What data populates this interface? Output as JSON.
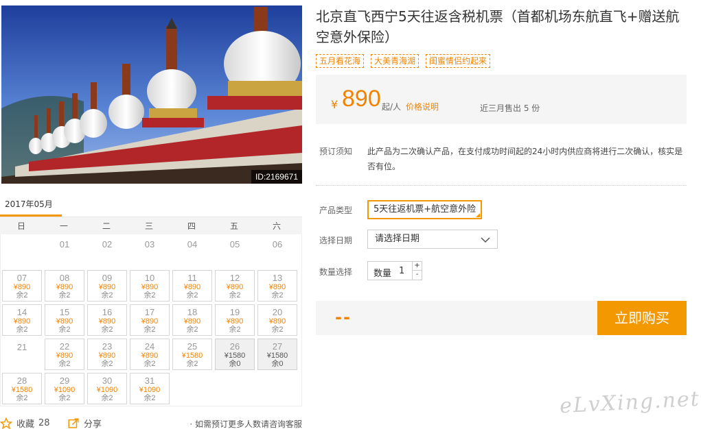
{
  "photo": {
    "id_label": "ID:2169671"
  },
  "calendar": {
    "month": "2017年05月",
    "weekdays": [
      "日",
      "一",
      "二",
      "三",
      "四",
      "五",
      "六"
    ],
    "days": [
      {
        "d": "",
        "p": "",
        "r": "",
        "s": "empty"
      },
      {
        "d": "01",
        "p": "",
        "r": "",
        "s": "plain"
      },
      {
        "d": "02",
        "p": "",
        "r": "",
        "s": "plain"
      },
      {
        "d": "03",
        "p": "",
        "r": "",
        "s": "plain"
      },
      {
        "d": "04",
        "p": "",
        "r": "",
        "s": "plain"
      },
      {
        "d": "05",
        "p": "",
        "r": "",
        "s": "plain"
      },
      {
        "d": "06",
        "p": "",
        "r": "",
        "s": "plain"
      },
      {
        "d": "07",
        "p": "¥890",
        "r": "余2",
        "s": "avail"
      },
      {
        "d": "08",
        "p": "¥890",
        "r": "余2",
        "s": "avail"
      },
      {
        "d": "09",
        "p": "¥890",
        "r": "余2",
        "s": "avail"
      },
      {
        "d": "10",
        "p": "¥890",
        "r": "余2",
        "s": "avail"
      },
      {
        "d": "11",
        "p": "¥890",
        "r": "余2",
        "s": "avail"
      },
      {
        "d": "12",
        "p": "¥890",
        "r": "余2",
        "s": "avail"
      },
      {
        "d": "13",
        "p": "¥890",
        "r": "余2",
        "s": "avail"
      },
      {
        "d": "14",
        "p": "¥890",
        "r": "余2",
        "s": "avail"
      },
      {
        "d": "15",
        "p": "¥890",
        "r": "余2",
        "s": "avail"
      },
      {
        "d": "16",
        "p": "¥890",
        "r": "余2",
        "s": "avail"
      },
      {
        "d": "17",
        "p": "¥890",
        "r": "余2",
        "s": "avail"
      },
      {
        "d": "18",
        "p": "¥890",
        "r": "余2",
        "s": "avail"
      },
      {
        "d": "19",
        "p": "¥890",
        "r": "余2",
        "s": "avail"
      },
      {
        "d": "20",
        "p": "¥890",
        "r": "余2",
        "s": "avail"
      },
      {
        "d": "21",
        "p": "",
        "r": "",
        "s": "plain"
      },
      {
        "d": "22",
        "p": "¥890",
        "r": "余2",
        "s": "avail"
      },
      {
        "d": "23",
        "p": "¥890",
        "r": "余2",
        "s": "avail"
      },
      {
        "d": "24",
        "p": "¥890",
        "r": "余2",
        "s": "avail"
      },
      {
        "d": "25",
        "p": "¥1580",
        "r": "余2",
        "s": "avail"
      },
      {
        "d": "26",
        "p": "¥1580",
        "r": "余0",
        "s": "soldout"
      },
      {
        "d": "27",
        "p": "¥1580",
        "r": "余0",
        "s": "soldout"
      },
      {
        "d": "28",
        "p": "¥1580",
        "r": "余2",
        "s": "avail"
      },
      {
        "d": "29",
        "p": "¥1090",
        "r": "余2",
        "s": "avail"
      },
      {
        "d": "30",
        "p": "¥1090",
        "r": "余2",
        "s": "avail"
      },
      {
        "d": "31",
        "p": "¥1090",
        "r": "余2",
        "s": "avail"
      }
    ]
  },
  "bottom": {
    "favorite_label": "收藏",
    "favorite_count": "28",
    "share_label": "分享",
    "note": "· 如需预订更多人数请咨询客服"
  },
  "product": {
    "title": "北京直飞西宁5天往返含税机票（首都机场东航直飞+赠送航空意外保险）",
    "tags": [
      "五月看花海",
      "大美青海湖",
      "闺蜜情侣约起来"
    ],
    "price": {
      "currency": "¥",
      "amount": "890",
      "unit": "起/人",
      "explain_link": "价格说明",
      "sold": "近三月售出 5 份"
    },
    "notice": {
      "label": "预订须知",
      "text": "此产品为二次确认产品，在支付成功时间起的24小时内供应商将进行二次确认，核实是否有位。"
    },
    "type_label": "产品类型",
    "type_value": "5天往返机票+航空意外险",
    "date_label": "选择日期",
    "date_placeholder": "请选择日期",
    "qty_label": "数量选择",
    "qty_inner_label": "数量",
    "qty_value": "1",
    "qty_plus": "+",
    "qty_minus": "-",
    "total": "--",
    "buy_label": "立即购买"
  },
  "watermark": "eLvXing.net",
  "colors": {
    "accent": "#f39800",
    "price": "#f08300"
  }
}
